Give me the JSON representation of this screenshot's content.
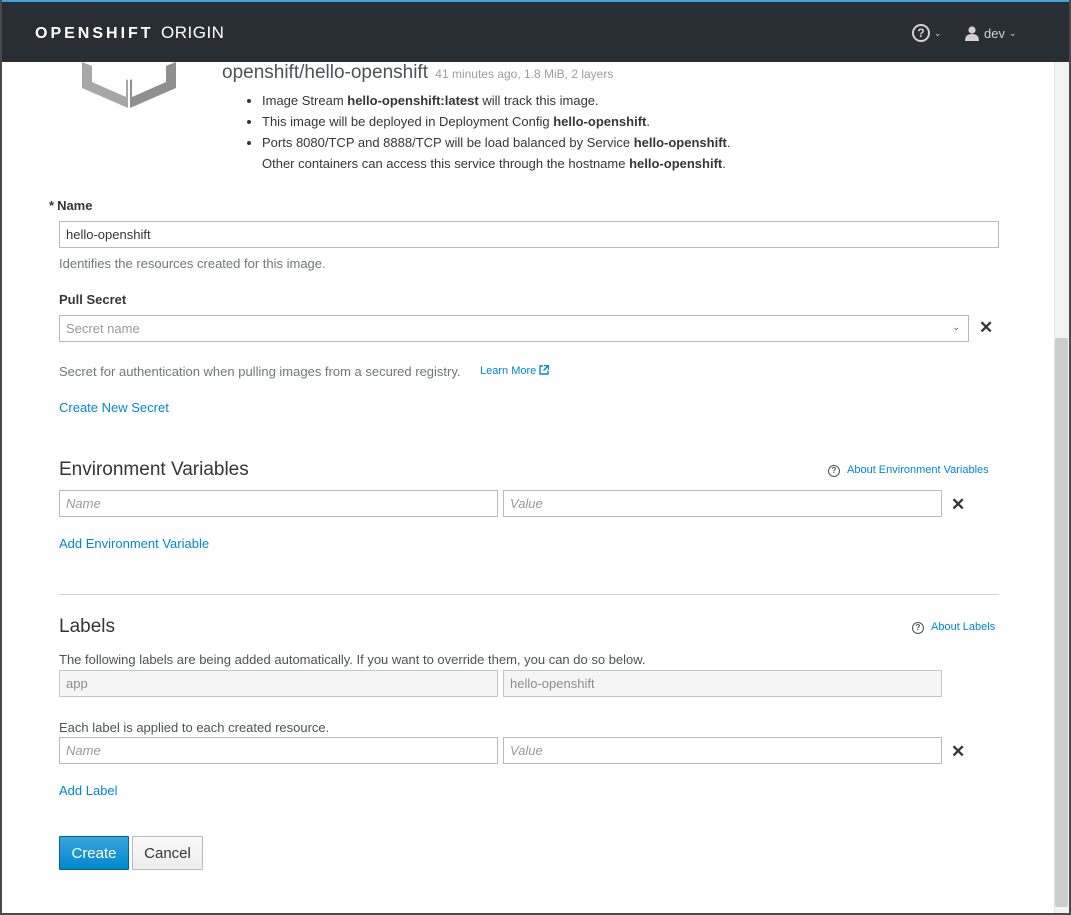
{
  "navbar": {
    "brand_bold": "OPENSHIFT",
    "brand_light": "ORIGIN",
    "help_icon": "question-circle-icon",
    "user_icon": "user-icon",
    "user_name": "dev"
  },
  "image": {
    "name": "openshift/hello-openshift",
    "meta": "41 minutes ago, 1.8 MiB, 2 layers",
    "bullets": {
      "b1_pre": "Image Stream ",
      "b1_bold": "hello-openshift:latest",
      "b1_post": " will track this image.",
      "b2_pre": "This image will be deployed in Deployment Config ",
      "b2_bold": "hello-openshift",
      "b2_post": ".",
      "b3_pre": "Ports 8080/TCP and 8888/TCP will be load balanced by Service ",
      "b3_bold": "hello-openshift",
      "b3_post": ".",
      "b3_line2_pre": "Other containers can access this service through the hostname ",
      "b3_line2_bold": "hello-openshift",
      "b3_line2_post": "."
    }
  },
  "form": {
    "name_required": "*",
    "name_label": "Name",
    "name_value": "hello-openshift",
    "name_help": "Identifies the resources created for this image.",
    "pull_secret_label": "Pull Secret",
    "pull_secret_placeholder": "Secret name",
    "pull_secret_help": "Secret for authentication when pulling images from a secured registry.",
    "learn_more": "Learn More",
    "create_secret": "Create New Secret"
  },
  "env": {
    "title": "Environment Variables",
    "about": "About Environment Variables",
    "name_placeholder": "Name",
    "value_placeholder": "Value",
    "add": "Add Environment Variable"
  },
  "labels": {
    "title": "Labels",
    "about": "About Labels",
    "auto_help": "The following labels are being added automatically. If you want to override them, you can do so below.",
    "auto_key": "app",
    "auto_value": "hello-openshift",
    "each_help": "Each label is applied to each created resource.",
    "name_placeholder": "Name",
    "value_placeholder": "Value",
    "add": "Add Label"
  },
  "actions": {
    "create": "Create",
    "cancel": "Cancel"
  },
  "colors": {
    "navbar_bg": "#292e34",
    "link": "#0088ce",
    "primary": "#0088ce"
  }
}
